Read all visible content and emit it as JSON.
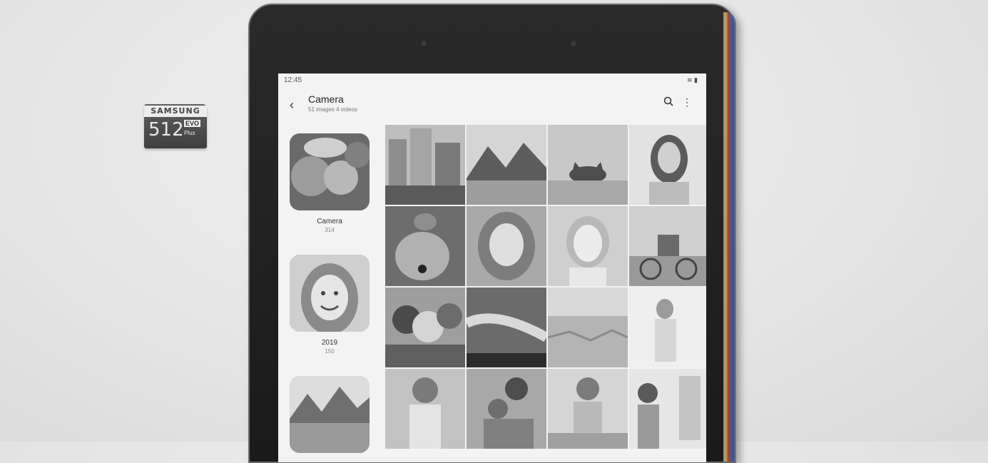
{
  "sdcard": {
    "brand": "SAMSUNG",
    "capacity": "512",
    "evo": "EVO",
    "class_mark": "Plus"
  },
  "status": {
    "time": "12:45"
  },
  "header": {
    "title": "Camera",
    "subtitle": "51 images 4 videos"
  },
  "albums": [
    {
      "name": "Camera",
      "count": "314"
    },
    {
      "name": "2019",
      "count": "150"
    },
    {
      "name": "",
      "count": ""
    }
  ],
  "photos": [
    {
      "subject": "city-street"
    },
    {
      "subject": "mountain-lake"
    },
    {
      "subject": "cat-peeking"
    },
    {
      "subject": "woman-portrait"
    },
    {
      "subject": "dog-with-cat"
    },
    {
      "subject": "girl-smiling"
    },
    {
      "subject": "girl-with-bow"
    },
    {
      "subject": "people-cycling"
    },
    {
      "subject": "friends-selfie"
    },
    {
      "subject": "aurora"
    },
    {
      "subject": "ice-field"
    },
    {
      "subject": "woman-sunlight"
    },
    {
      "subject": "boy-laughing"
    },
    {
      "subject": "mother-child"
    },
    {
      "subject": "girl-beach"
    },
    {
      "subject": "women-window"
    }
  ]
}
